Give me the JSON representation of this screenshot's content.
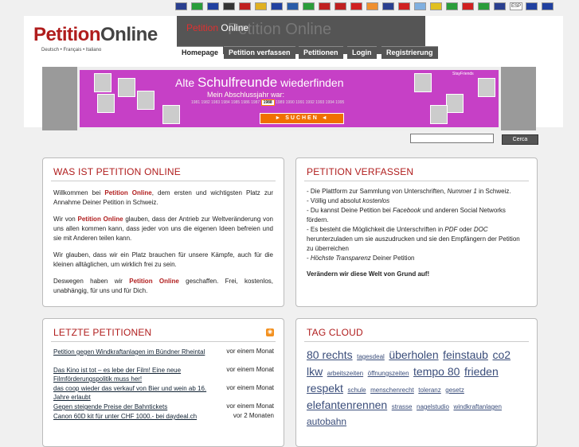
{
  "flags": [
    {
      "name": "uk-flag",
      "color": "#2a3f8f",
      "txt": ""
    },
    {
      "name": "it-flag",
      "color": "#2a9d3a",
      "txt": ""
    },
    {
      "name": "fr-flag",
      "color": "#2040a0",
      "txt": ""
    },
    {
      "name": "de-flag",
      "color": "#333333",
      "txt": ""
    },
    {
      "name": "nl-flag",
      "color": "#c02020",
      "txt": ""
    },
    {
      "name": "es-flag",
      "color": "#e0b020",
      "txt": ""
    },
    {
      "name": "ro-flag",
      "color": "#2040a0",
      "txt": ""
    },
    {
      "name": "se-flag",
      "color": "#2a5ca8",
      "txt": ""
    },
    {
      "name": "mx-flag",
      "color": "#2a9d3a",
      "txt": ""
    },
    {
      "name": "cz-flag",
      "color": "#c02020",
      "txt": ""
    },
    {
      "name": "at-flag",
      "color": "#c02020",
      "txt": ""
    },
    {
      "name": "ch-flag",
      "color": "#d02020",
      "txt": ""
    },
    {
      "name": "in-flag",
      "color": "#f09030",
      "txt": ""
    },
    {
      "name": "au-flag",
      "color": "#2a3f8f",
      "txt": ""
    },
    {
      "name": "tr-flag",
      "color": "#d02020",
      "txt": ""
    },
    {
      "name": "ar-flag",
      "color": "#80b0e0",
      "txt": ""
    },
    {
      "name": "co-flag",
      "color": "#e0c020",
      "txt": ""
    },
    {
      "name": "br-flag",
      "color": "#2a9d3a",
      "txt": ""
    },
    {
      "name": "ca-flag",
      "color": "#d02020",
      "txt": ""
    },
    {
      "name": "it2-flag",
      "color": "#2a9d3a",
      "txt": ""
    },
    {
      "name": "nz-flag",
      "color": "#2a3f8f",
      "txt": ""
    },
    {
      "name": "esp-flag",
      "color": "#ffffff",
      "txt": "ESP"
    },
    {
      "name": "eu-flag",
      "color": "#2040a0",
      "txt": ""
    },
    {
      "name": "fr2-flag",
      "color": "#2040a0",
      "txt": ""
    }
  ],
  "header": {
    "logo_a": "Petition",
    "logo_b": "Online",
    "languages": "Deutsch • Français • Italiano",
    "strip_title_a": "Petition",
    "strip_title_b": " Online",
    "strip_ghost": "Petition Online"
  },
  "nav": [
    {
      "label": "Homepage",
      "active": true
    },
    {
      "label": "Petition verfassen",
      "active": false
    },
    {
      "label": "Petitionen",
      "active": false
    },
    {
      "label": "Login",
      "active": false
    },
    {
      "label": "Registrierung",
      "active": false
    }
  ],
  "banner": {
    "title_a": "Alte ",
    "title_big": "Schulfreunde",
    "title_b": " wiederfinden",
    "subtitle": "Mein Abschlussjahr war:",
    "years_before": "1981 1982 1983 1984 1985 1986 1987",
    "year_selected": "1988",
    "years_after": "1989 1990 1991 1992 1993 1994 1995",
    "button": "► SUCHEN ◄",
    "brand": "StayFriends"
  },
  "search": {
    "placeholder": "",
    "button": "Cerca"
  },
  "was_ist": {
    "title": "WAS IST PETITION ONLINE",
    "p1a": "Willkommen bei ",
    "p1b": "Petition Online",
    "p1c": ", dem ersten und wichtigsten Platz zur Annahme Deiner Petition in Schweiz.",
    "p2a": "Wir von ",
    "p2b": "Petition Online",
    "p2c": " glauben, dass der Antrieb zur Weltveränderung von uns allen kommen kann, dass jeder von uns die eigenen Ideen befreien und sie mit Anderen teilen kann.",
    "p3": "Wir glauben, dass wir ein Platz brauchen für unsere Kämpfe, auch für die kleinen alltäglichen, um wirklich frei zu sein.",
    "p4a": "Deswegen haben wir ",
    "p4b": "Petition Online",
    "p4c": " geschaffen. Frei, kostenlos, unabhängig, für uns und für Dich."
  },
  "verfassen": {
    "title": "PETITION VERFASSEN",
    "l1a": "- Die Plattform zur Sammlung von Unterschriften, ",
    "l1b": "Nummer 1",
    "l1c": " in Schweiz.",
    "l2a": "- Völlig und absolut ",
    "l2b": "kostenlos",
    "l3a": "- Du kannst Deine Petition bei ",
    "l3b": "Facebook",
    "l3c": " und anderen Social Networks fördern.",
    "l4a": "- Es besteht die Möglichkeit die Unterschriften in ",
    "l4b": "PDF",
    "l4c": " oder ",
    "l4d": "DOC",
    "l4e": " herunterzuladen um sie auszudrucken und sie den Empfängern der Petition zu überreichen",
    "l5a": "- ",
    "l5b": "Höchste Transparenz",
    "l5c": " Deiner Petition",
    "slogan": "Verändern wir diese Welt von Grund auf!"
  },
  "letzte": {
    "title": "LETZTE PETITIONEN",
    "items": [
      {
        "title": "Petition gegen Windkraftanlagen im Bündner Rheintal",
        "when": "vor einem Monat"
      },
      {
        "title": "Das Kino ist tot – es lebe der Film! Eine neue Filmförderungspolitik muss her!",
        "when": "vor einem Monat"
      },
      {
        "title": "das coop wieder das verkauf von Bier und wein ab 16. Jahre erlaubt",
        "when": "vor einem Monat"
      },
      {
        "title": "Gegen steigende Preise der Bahntickets",
        "when": "vor einem Monat"
      },
      {
        "title": "Canon 60D kit für unter CHF 1000.- bei daydeal.ch",
        "when": "vor 2 Monaten"
      }
    ]
  },
  "tagcloud": {
    "title": "TAG CLOUD",
    "tags": [
      {
        "t": "80 rechts",
        "s": 14
      },
      {
        "t": "tagesdeal",
        "s": 8
      },
      {
        "t": "überholen",
        "s": 14
      },
      {
        "t": "feinstaub",
        "s": 14
      },
      {
        "t": "co2",
        "s": 14
      },
      {
        "t": "lkw",
        "s": 14
      },
      {
        "t": "arbeitszeiten",
        "s": 8
      },
      {
        "t": "öffnungszeiten",
        "s": 8
      },
      {
        "t": "tempo 80",
        "s": 14
      },
      {
        "t": "frieden",
        "s": 14
      },
      {
        "t": "respekt",
        "s": 14
      },
      {
        "t": "schule",
        "s": 8
      },
      {
        "t": "menschenrecht",
        "s": 8
      },
      {
        "t": "toleranz",
        "s": 8
      },
      {
        "t": "gesetz",
        "s": 8
      },
      {
        "t": "elefantenrennen",
        "s": 14
      },
      {
        "t": "strasse",
        "s": 8
      },
      {
        "t": "nagelstudio",
        "s": 8
      },
      {
        "t": "windkraftanlagen",
        "s": 8
      },
      {
        "t": "autobahn",
        "s": 12
      }
    ]
  }
}
